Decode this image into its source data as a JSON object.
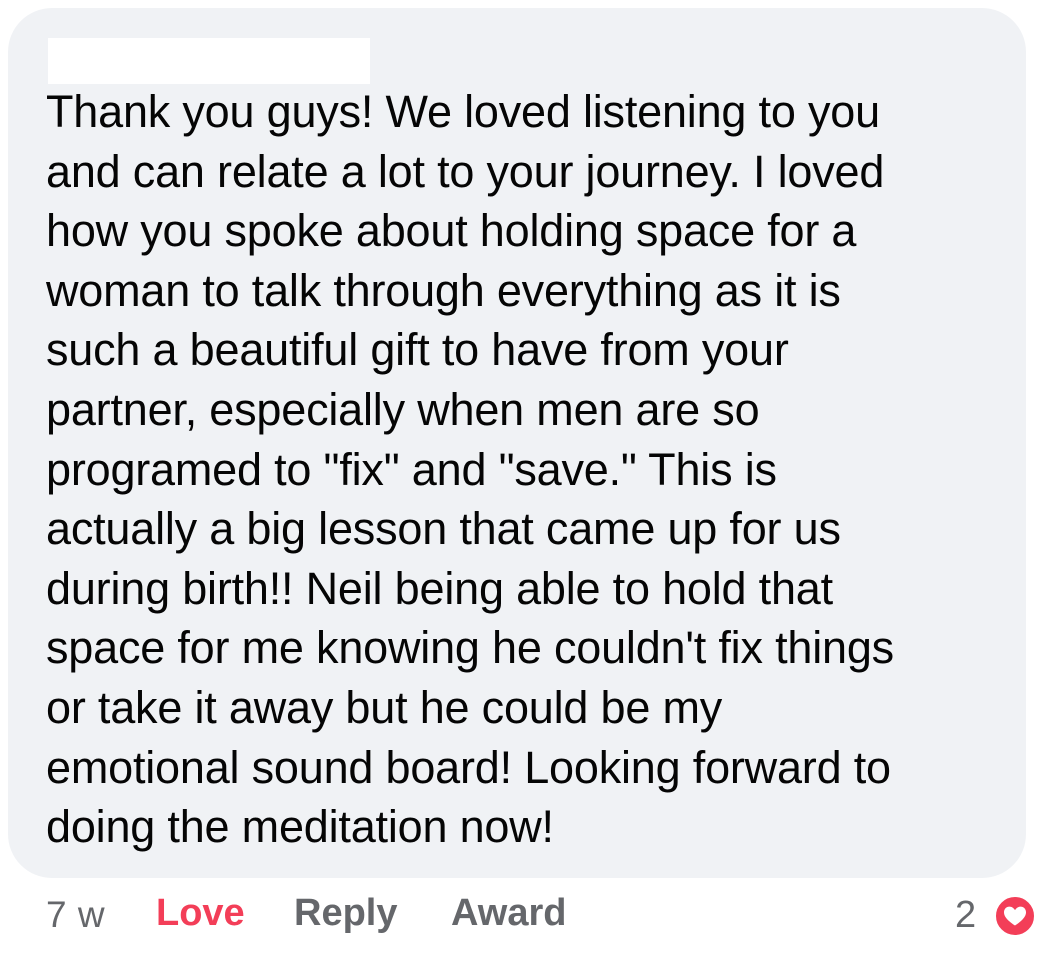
{
  "comment": {
    "lines": [
      "Thank you guys! We loved listening to you",
      "and can relate a lot to your journey. I loved",
      "how you spoke about holding space for a",
      "woman to talk through everything as it is",
      "such a beautiful gift to have from your",
      "partner, especially when men are so",
      "programed to \"fix\" and \"save.\" This is",
      "actually a big lesson that came up for us",
      "during birth!! Neil being able to hold that",
      "space for me knowing he couldn't fix things",
      "or take it away but he could be my",
      "emotional sound board! Looking forward to",
      "doing the meditation now!"
    ]
  },
  "actions": {
    "timestamp": "7 w",
    "love_label": "Love",
    "reply_label": "Reply",
    "award_label": "Award"
  },
  "reactions": {
    "count": "2",
    "icon": "heart-icon",
    "color": "#f33e58"
  }
}
